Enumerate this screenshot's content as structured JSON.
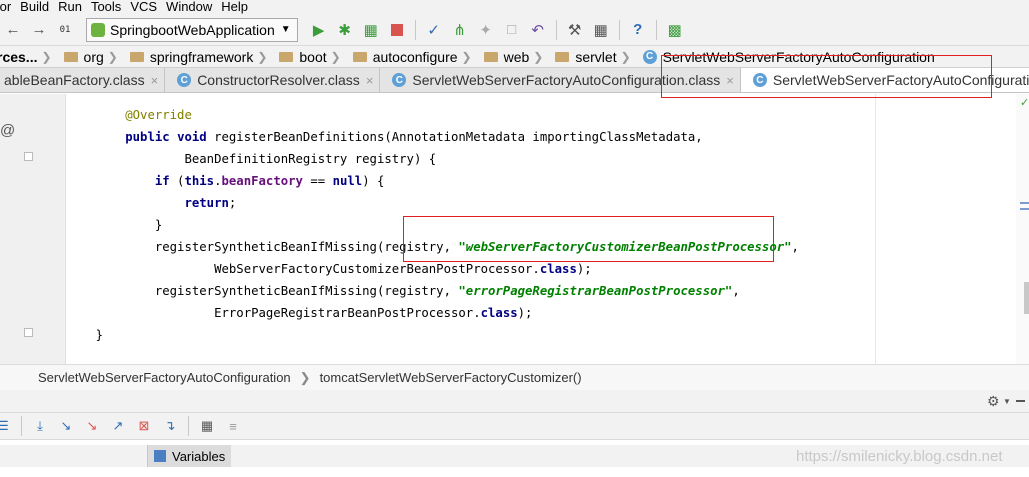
{
  "menu": [
    "tor",
    "Build",
    "Run",
    "Tools",
    "VCS",
    "Window",
    "Help"
  ],
  "toolbar": {
    "run_config": "SpringbootWebApplication",
    "icons": [
      "back-arrow-icon",
      "forward-arrow-icon",
      "binary-icon",
      "run-icon",
      "debug-icon",
      "coverage-icon",
      "stop-icon",
      "build-icon",
      "vcs-icon",
      "update-icon",
      "commit-icon",
      "revert-icon",
      "settings-icon",
      "structure-icon",
      "help-icon",
      "plugin-icon"
    ]
  },
  "breadcrumb": {
    "items": [
      "rces...",
      "org",
      "springframework",
      "boot",
      "autoconfigure",
      "web",
      "servlet",
      "ServletWebServerFactoryAutoConfiguration"
    ]
  },
  "tabs": [
    {
      "label": "ableBeanFactory.class",
      "active": false
    },
    {
      "label": "ConstructorResolver.class",
      "active": false
    },
    {
      "label": "ServletWebServerFactoryAutoConfiguration.class",
      "active": false
    },
    {
      "label": "ServletWebServerFactoryAutoConfiguration.java",
      "active": true
    }
  ],
  "tabs_overflow": "≡¹",
  "code": {
    "l1": "@Override",
    "l2_kw1": "public",
    "l2_kw2": "void",
    "l2_rest": " registerBeanDefinitions(AnnotationMetadata importingClassMetadata,",
    "l3": "        BeanDefinitionRegistry registry) {",
    "l4_kw1": "if",
    "l4_kw2": "this",
    "l4_field": "beanFactory",
    "l4_op": " == ",
    "l4_kw3": "null",
    "l4_end": ") {",
    "l5_kw": "return",
    "l6": "    }",
    "l7_pre": "    registerSyntheticBeanIfMissing(registry, ",
    "l7_str": "\"webServerFactoryCustomizerBeanPostProcessor\"",
    "l7_end": ",",
    "l8_pre": "            WebServerFactoryCustomizerBeanPostProcessor.",
    "l8_kw": "class",
    "l8_end": ");",
    "l9_pre": "    registerSyntheticBeanIfMissing(registry, ",
    "l9_str": "\"errorPageRegistrarBeanPostProcessor\"",
    "l9_end": ",",
    "l10_pre": "            ErrorPageRegistrarBeanPostProcessor.",
    "l10_kw": "class",
    "l10_end": ");",
    "l11": "}"
  },
  "code_breadcrumb": {
    "class": "ServletWebServerFactoryAutoConfiguration",
    "method": "tomcatServletWebServerFactoryCustomizer()"
  },
  "debug": {
    "variables_label": "Variables"
  },
  "watermark": "https://smilenicky.blog.csdn.net",
  "colors": {
    "highlight_box": "#e02020",
    "keyword": "#000080",
    "string": "#008000",
    "annotation": "#808000",
    "field": "#660e7a"
  }
}
